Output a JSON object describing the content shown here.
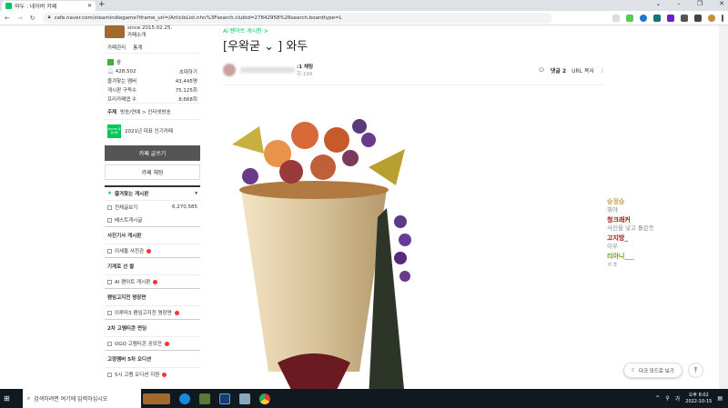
{
  "browser": {
    "tab_title": "와두 : 네이버 카페",
    "url": "cafe.naver.com/steamindiegame?iframe_url=/ArticleList.nhn%3Fsearch.clubid=27842958%26search.boardtype=L"
  },
  "sidebar": {
    "since": "since 2015.02.25.",
    "intro": "카페소개",
    "manage": "카페관리",
    "stats": "통계",
    "level": "숲",
    "members": "428,502",
    "invite": "초대하기",
    "fav_members_label": "즐겨찾는 멤버",
    "fav_members": "43,445명",
    "subs_label": "게시판 구독수",
    "subs": "75,125회",
    "visits_label": "프리카페앱 수",
    "visits": "8,668회",
    "topic_label": "주제",
    "topic": "방송/연예 > 인터넷방송",
    "badge": "NAVER 대표카페",
    "badge_text": "2021년 대표 인기카페",
    "write_btn": "카페 글쓰기",
    "chat_btn": "카페 채팅",
    "fav_boards": "즐겨찾는 게시판",
    "all_posts": "전체글보기",
    "all_count": "6,270,585",
    "best": "베스트게시글",
    "sections": [
      {
        "title": "사진기사 게시판",
        "item": "이세돌 사진관"
      },
      {
        "title": "기계로 선 쌀",
        "item": "AI 팬아트 게시판"
      },
      {
        "title": "팬임고지전 명장면",
        "item": "이루마3 팬임고지전 명장면"
      },
      {
        "title": "2차 고멤티콘 펀딩",
        "item": "OGQ 고멤티콘 공모전"
      },
      {
        "title": "고정멤버 5차 오디션",
        "item": "5시 고멤 오디션 지원"
      }
    ]
  },
  "article": {
    "breadcrumb": "AI 팬아트 게시판 >",
    "title": "[우왁굳 ⌄ ] 와두",
    "author_suffix": ":1 채팅",
    "views": "회 199",
    "comments": "댓글 2",
    "url_copy": "URL 복사"
  },
  "chat": [
    {
      "name": "승정승",
      "msg": "뭐야",
      "color": "#c8a050"
    },
    {
      "name": "청크래커",
      "msg": "사진을 넣고 돌린듯",
      "color": "#a01010"
    },
    {
      "name": "고지방_",
      "msg": "이우",
      "color": "#a01010"
    },
    {
      "name": "리아니___",
      "msg": "ㅇㅎ",
      "color": "#6a9a10"
    }
  ],
  "buttons": {
    "dark_mode": "다크 모드로 보기",
    "top": "⤒"
  },
  "taskbar": {
    "search": "검색하려면 여기에 입력하십시오",
    "time": "오후 8:02",
    "date": "2022-10-15"
  }
}
